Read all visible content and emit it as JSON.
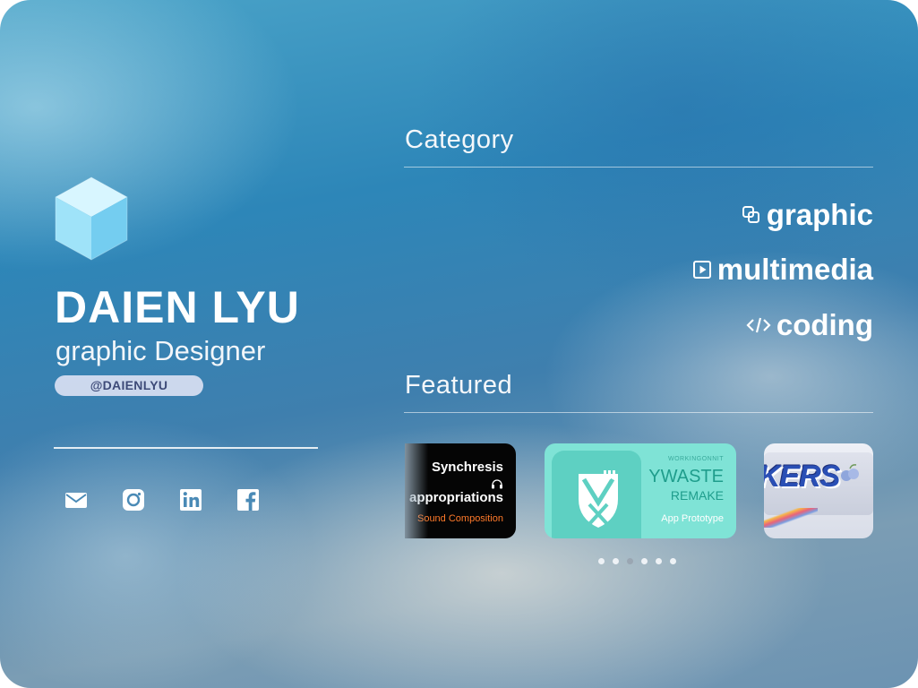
{
  "profile": {
    "name": "DAIEN LYU",
    "role": "graphic Designer",
    "handle": "@DAIENLYU",
    "logo_icon": "cube-icon",
    "social_icons": [
      "mail-icon",
      "instagram-icon",
      "linkedin-icon",
      "facebook-icon"
    ]
  },
  "category": {
    "title": "Category",
    "items": [
      {
        "label": "graphic",
        "icon": "copy-squares-icon"
      },
      {
        "label": "multimedia",
        "icon": "play-square-icon"
      },
      {
        "label": "coding",
        "icon": "code-brackets-icon"
      }
    ]
  },
  "featured": {
    "title": "Featured",
    "cards": [
      {
        "line1": "Synchresis",
        "line2": "appropriations",
        "tag": "Sound Composition",
        "icon": "headphones-icon"
      },
      {
        "small": "WORKINGONNIT",
        "title": "YWASTE",
        "subtitle": "REMAKE",
        "tag": "App Prototype",
        "icon": "fork-knife-shield-icon"
      },
      {
        "logo": "KERS",
        "icon": "berries-icon"
      }
    ],
    "pager": {
      "count": 6,
      "active_index": 2
    }
  },
  "colors": {
    "handle_bg": "#e6e8f8",
    "handle_text": "#3d4a78",
    "synch_tag": "#ff7a2a",
    "ywaste_card": "#7fe3d6",
    "ywaste_text": "#1f9d8c"
  }
}
